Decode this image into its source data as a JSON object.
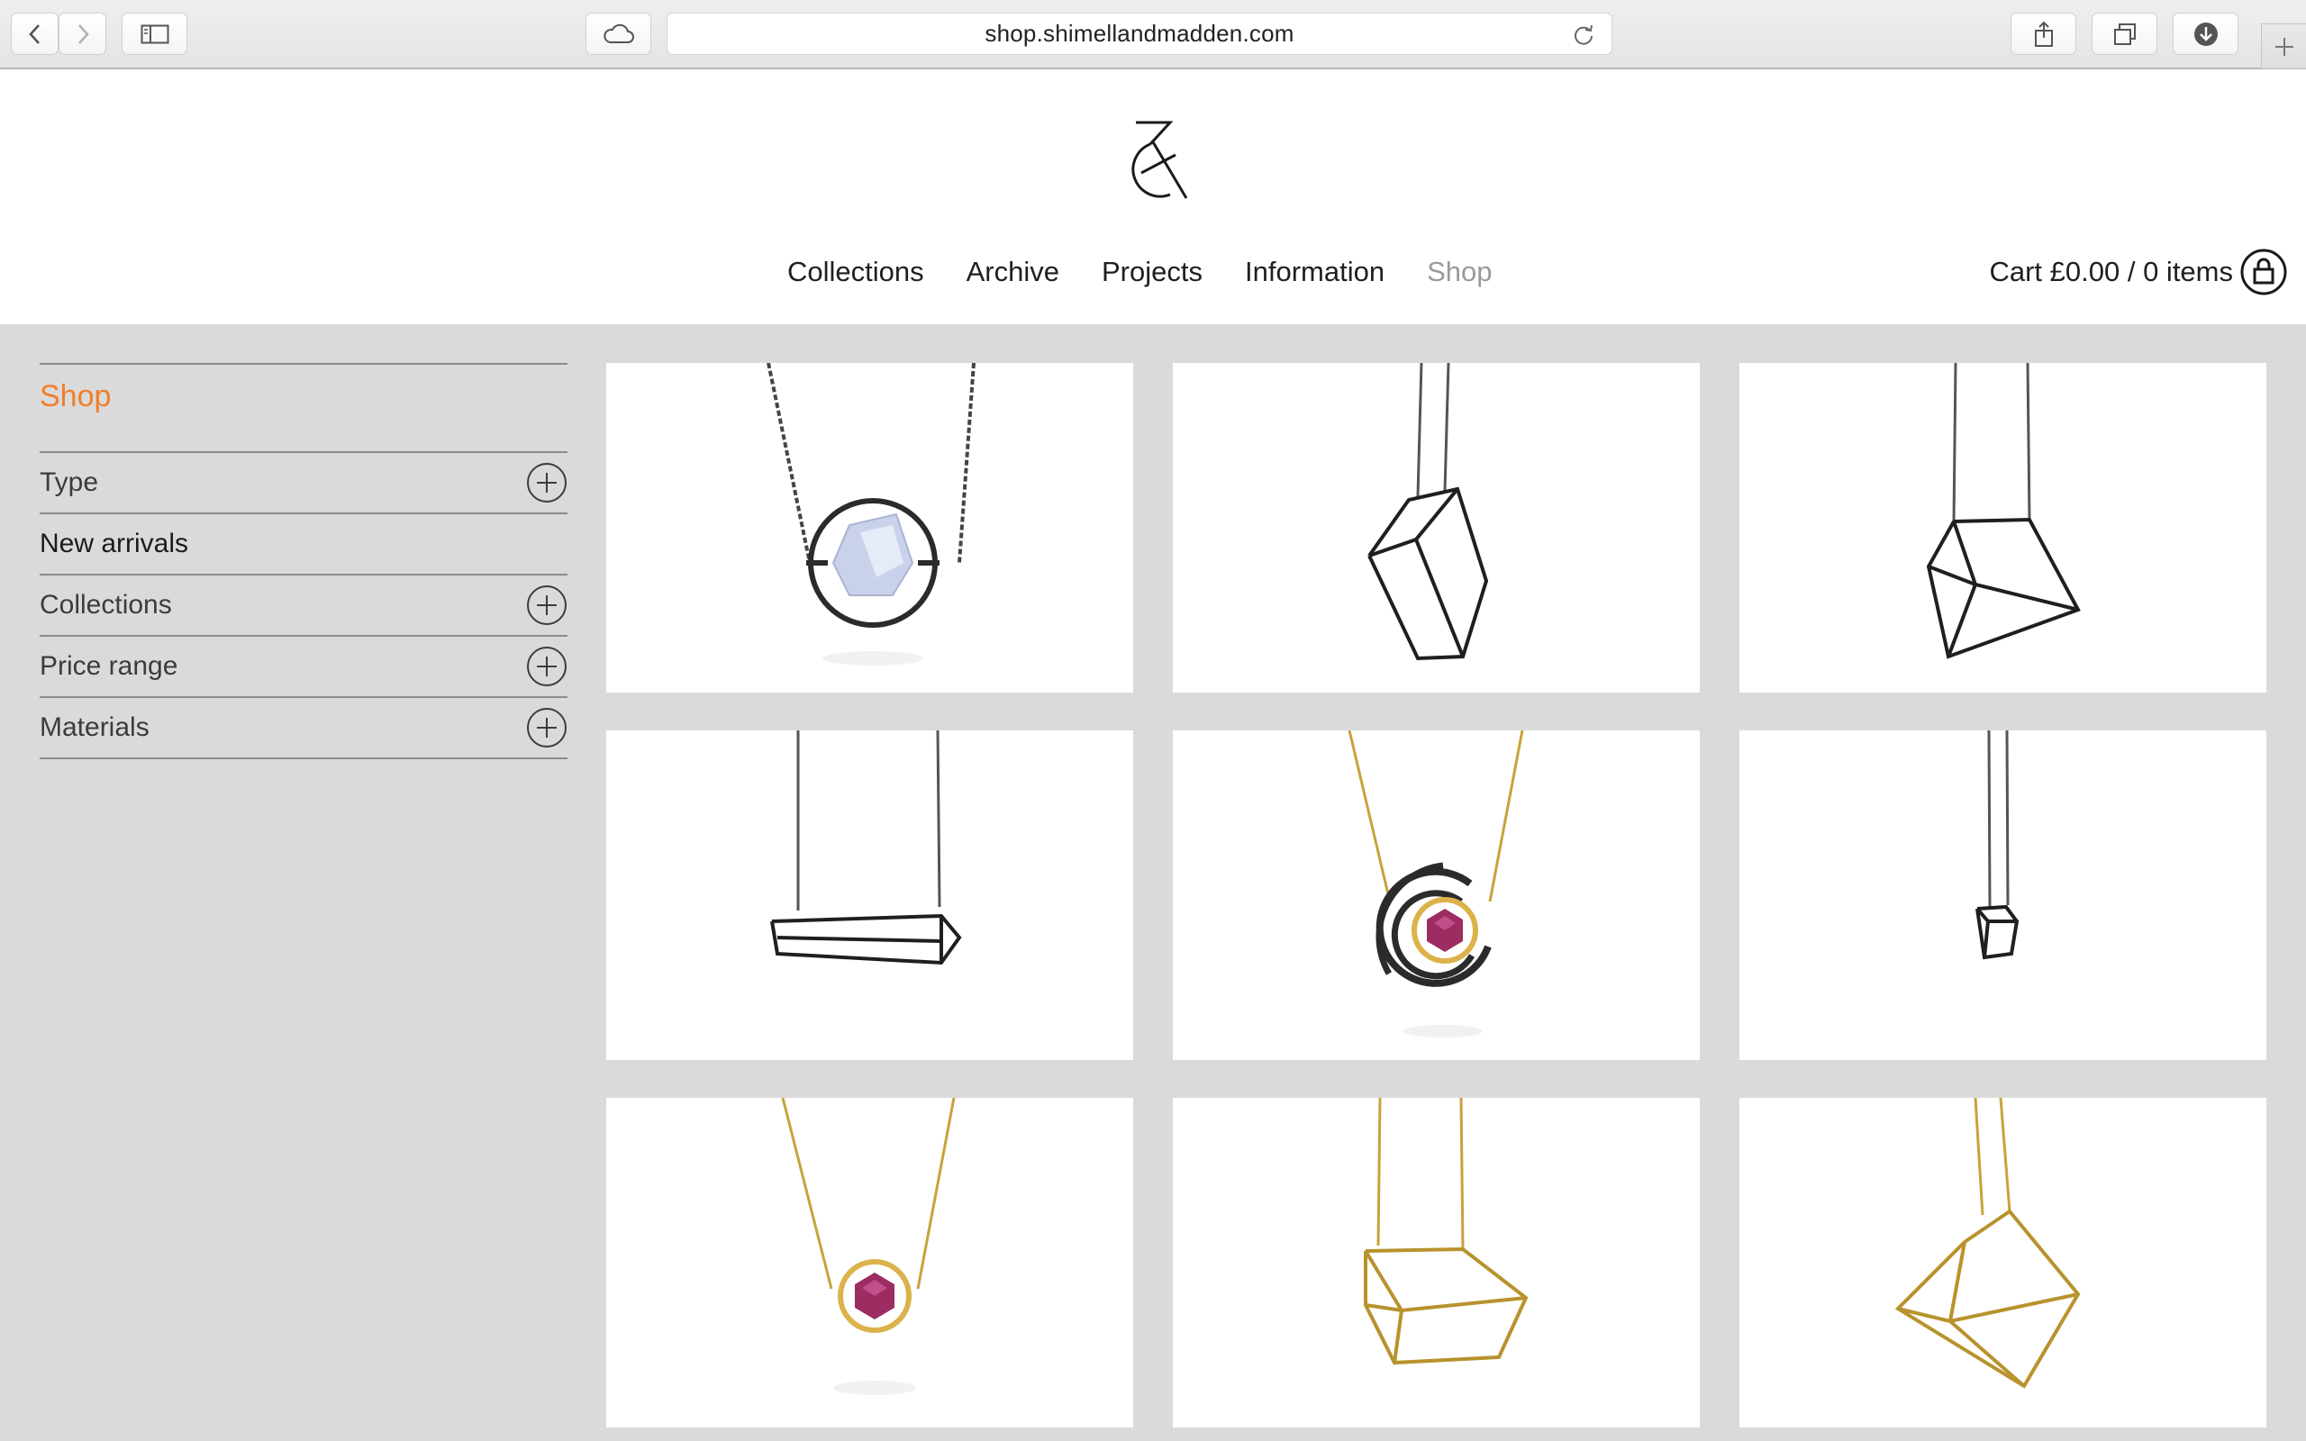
{
  "browser": {
    "url": "shop.shimellandmadden.com",
    "icons": [
      "back-arrow-icon",
      "forward-arrow-icon",
      "sidebar-icon",
      "icloud-tabs-icon",
      "reload-icon",
      "share-icon",
      "tabs-overview-icon",
      "downloads-icon",
      "new-tab-plus-icon"
    ]
  },
  "nav": {
    "items": [
      {
        "label": "Collections"
      },
      {
        "label": "Archive"
      },
      {
        "label": "Projects"
      },
      {
        "label": "Information"
      },
      {
        "label": "Shop",
        "active": true
      }
    ]
  },
  "cart": {
    "label": "Cart £0.00 / 0 items",
    "icon": "shopping-bag-icon"
  },
  "sidebar": {
    "title": "Shop",
    "filters": [
      {
        "label": "Type",
        "expandable": true
      },
      {
        "label": "New arrivals",
        "expandable": false
      },
      {
        "label": "Collections",
        "expandable": true
      },
      {
        "label": "Price range",
        "expandable": true
      },
      {
        "label": "Materials",
        "expandable": true
      }
    ]
  },
  "products": [
    {
      "image": "silver-ring-pendant-with-blue-stone"
    },
    {
      "image": "black-tilted-cuboid-pendant"
    },
    {
      "image": "black-cube-pendant"
    },
    {
      "image": "black-bar-cuboid-pendant"
    },
    {
      "image": "gold-spiral-pendant-with-pink-hexagon-stone"
    },
    {
      "image": "small-black-cube-pendant"
    },
    {
      "image": "gold-ring-pendant-with-pink-hexagon-stone"
    },
    {
      "image": "gold-cuboid-pendant"
    },
    {
      "image": "gold-tilted-cube-pendant"
    }
  ],
  "colors": {
    "accent": "#f17e2a",
    "page_background": "#dadada",
    "text": "#1f1f1f",
    "muted_nav": "#9a9a9a",
    "gold": "#c9a23a",
    "oxidised_silver": "#2b2b2b"
  }
}
